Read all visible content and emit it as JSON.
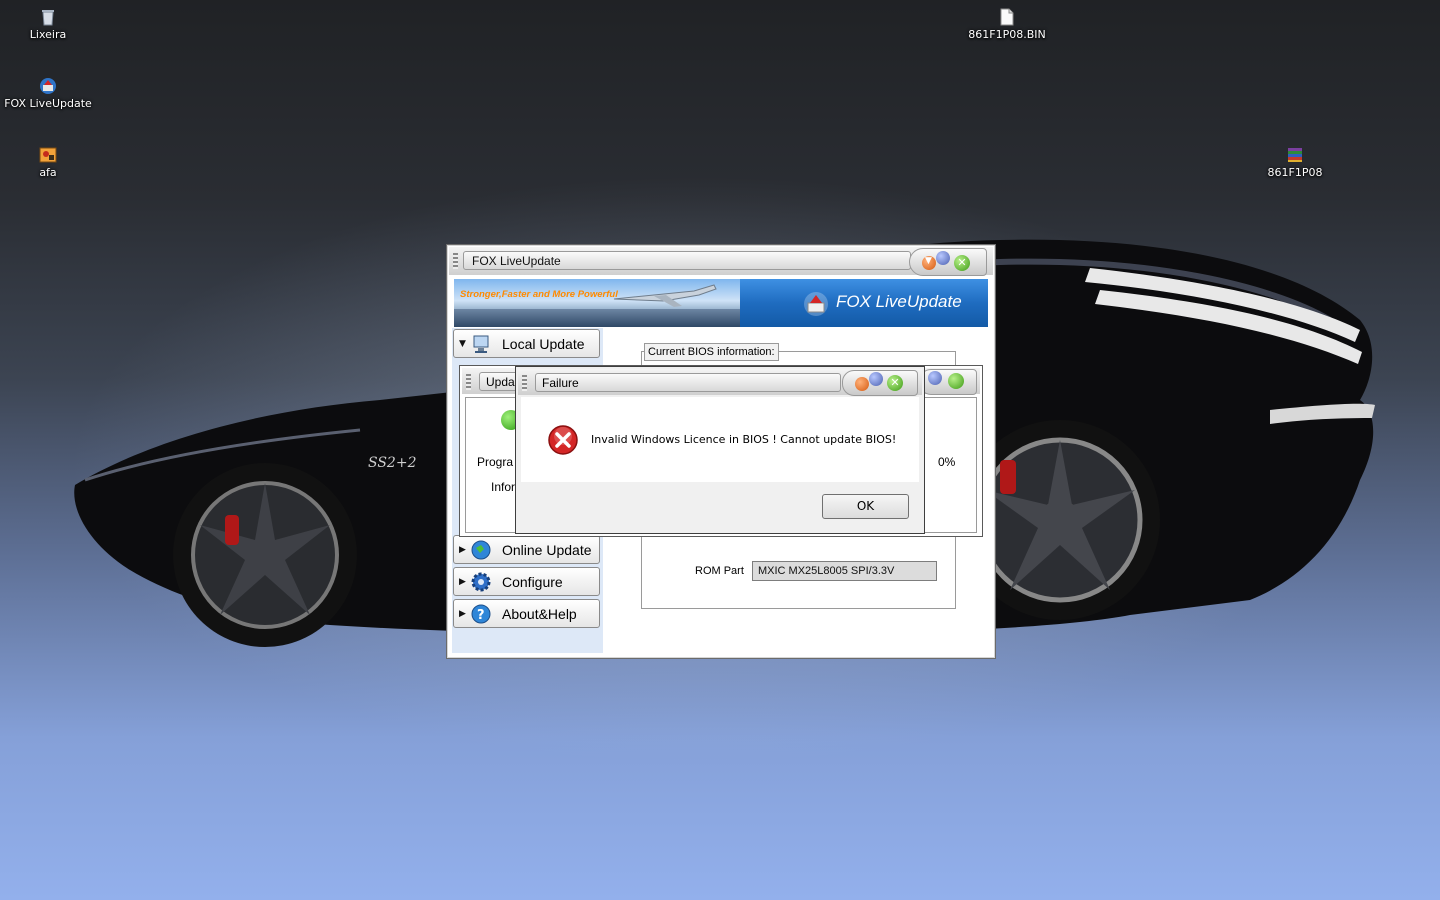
{
  "desktop": {
    "icons": [
      {
        "label": "Lixeira",
        "icon": "recycle-bin-icon"
      },
      {
        "label": "FOX LiveUpdate",
        "icon": "fox-liveupdate-icon"
      },
      {
        "label": "afa",
        "icon": "image-file-icon"
      },
      {
        "label": "861F1P08.BIN",
        "icon": "document-icon"
      },
      {
        "label": "861F1P08",
        "icon": "archive-icon"
      }
    ]
  },
  "main_window": {
    "title": "FOX LiveUpdate",
    "banner": {
      "slogan": "Stronger,Faster and More Powerful",
      "brand": "FOX LiveUpdate"
    },
    "nav": [
      {
        "label": "Local Update",
        "expanded": true,
        "icon": "monitor-icon"
      },
      {
        "label": "Online Update",
        "expanded": false,
        "icon": "globe-icon"
      },
      {
        "label": "Configure",
        "expanded": false,
        "icon": "gear-icon"
      },
      {
        "label": "About&Help",
        "expanded": false,
        "icon": "help-icon"
      }
    ],
    "bios_group_title": "Current BIOS information:",
    "rom_part_label": "ROM Part",
    "rom_part_value": "MXIC MX25L8005 SPI/3.3V"
  },
  "update_dialog": {
    "title_visible": "Upda",
    "program_label_visible": "Progra",
    "info_label_visible": "Infor",
    "progress_percent": "0%"
  },
  "failure_dialog": {
    "title": "Failure",
    "message": "Invalid Windows Licence in BIOS !  Cannot update BIOS!",
    "ok_label": "OK"
  },
  "colors": {
    "banner_blue": "#1e73c8",
    "slogan_orange": "#ff8a00",
    "close_green": "#3c9a14",
    "error_red": "#d42626"
  }
}
